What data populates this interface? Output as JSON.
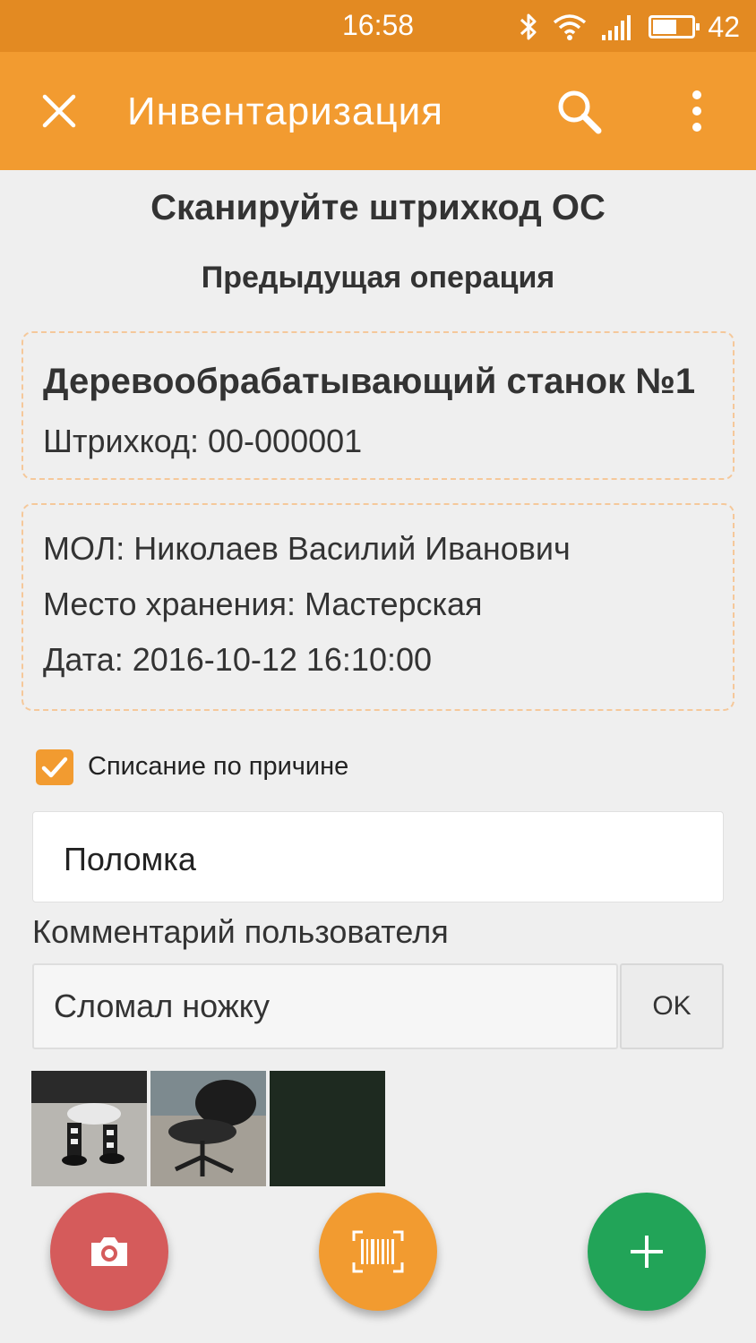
{
  "status_bar": {
    "time": "16:58",
    "battery": "42"
  },
  "app_bar": {
    "title": "Инвентаризация",
    "icons": [
      "close-icon",
      "search-icon",
      "more-vert-icon"
    ]
  },
  "main": {
    "scan_prompt": "Сканируйте штрихкод ОС",
    "previous_operation": "Предыдущая операция",
    "asset": {
      "name": "Деревообрабатывающий станок №1",
      "barcode": "Штрихкод: 00-000001"
    },
    "details": {
      "mol": "МОЛ: Николаев Василий Иванович",
      "location": "Место хранения: Мастерская",
      "date": "Дата: 2016-10-12 16:10:00"
    },
    "writeoff": {
      "label": "Списание по причине",
      "checked": true
    },
    "reason": "Поломка",
    "comment": {
      "label": "Комментарий пользователя",
      "value": "Сломал ножку",
      "ok_label": "OK"
    }
  },
  "fabs": [
    "camera-icon",
    "barcode-scan-icon",
    "add-icon"
  ],
  "colors": {
    "status_bar": "#e38a22",
    "accent": "#f29b30",
    "camera_fab": "#d55b5b",
    "add_fab": "#22a458"
  }
}
